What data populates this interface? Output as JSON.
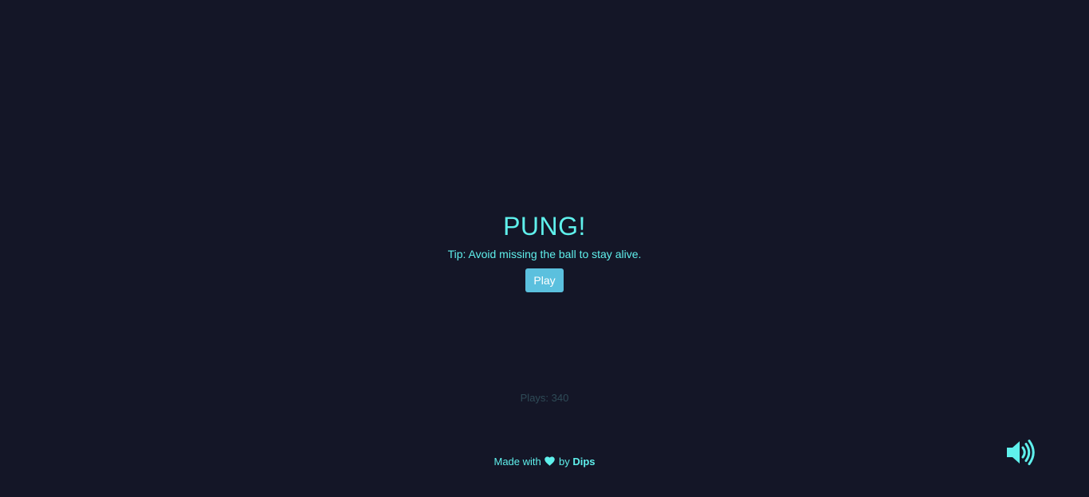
{
  "game": {
    "title": "PUNG!",
    "tip": "Tip: Avoid missing the ball to stay alive.",
    "play_label": "Play",
    "plays_text": "Plays: 340"
  },
  "footer": {
    "made_with": "Made with",
    "by": "by",
    "author": "Dips",
    "heart_icon": "heart-icon"
  },
  "controls": {
    "sound_icon": "volume-up-icon"
  },
  "colors": {
    "background": "#141627",
    "accent": "#5ff0ec",
    "button": "#5bc0de",
    "muted": "#2f4b57"
  }
}
